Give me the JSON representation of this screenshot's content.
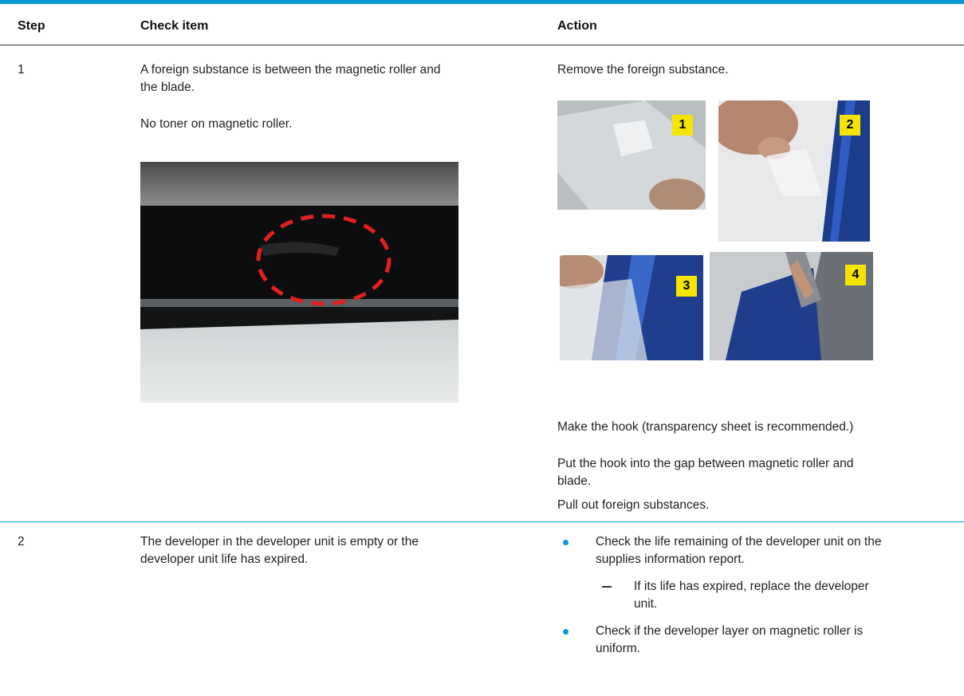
{
  "header": {
    "step": "Step",
    "check_item": "Check item",
    "action": "Action"
  },
  "row1": {
    "step": "1",
    "check_item_1": "A foreign substance is between the magnetic roller and",
    "check_item_2": "the blade.",
    "check_note": "No toner on magnetic roller.",
    "action_1": "Remove the foreign substance.",
    "photo_labels": [
      "1",
      "2",
      "3",
      "4"
    ],
    "action_2": "Make the hook (transparency sheet is recommended.)",
    "action_3a": "Put the hook into the gap between magnetic roller and",
    "action_3b": "blade.",
    "action_4": "Pull out foreign substances."
  },
  "row2": {
    "step": "2",
    "check_item_1": "The developer in the developer unit is empty or the",
    "check_item_2": "developer unit life has expired.",
    "bullet1_a": "Check the life remaining of the developer unit on the",
    "bullet1_b": "supplies information report.",
    "sub1_a": "If its life has expired, replace the developer",
    "sub1_b": "unit.",
    "bullet2_a": "Check if the developer layer on magnetic roller is",
    "bullet2_b": "uniform."
  },
  "colors": {
    "accent": "#0d96d4",
    "badge": "#f4e400",
    "highlight_ring": "#e02020"
  }
}
